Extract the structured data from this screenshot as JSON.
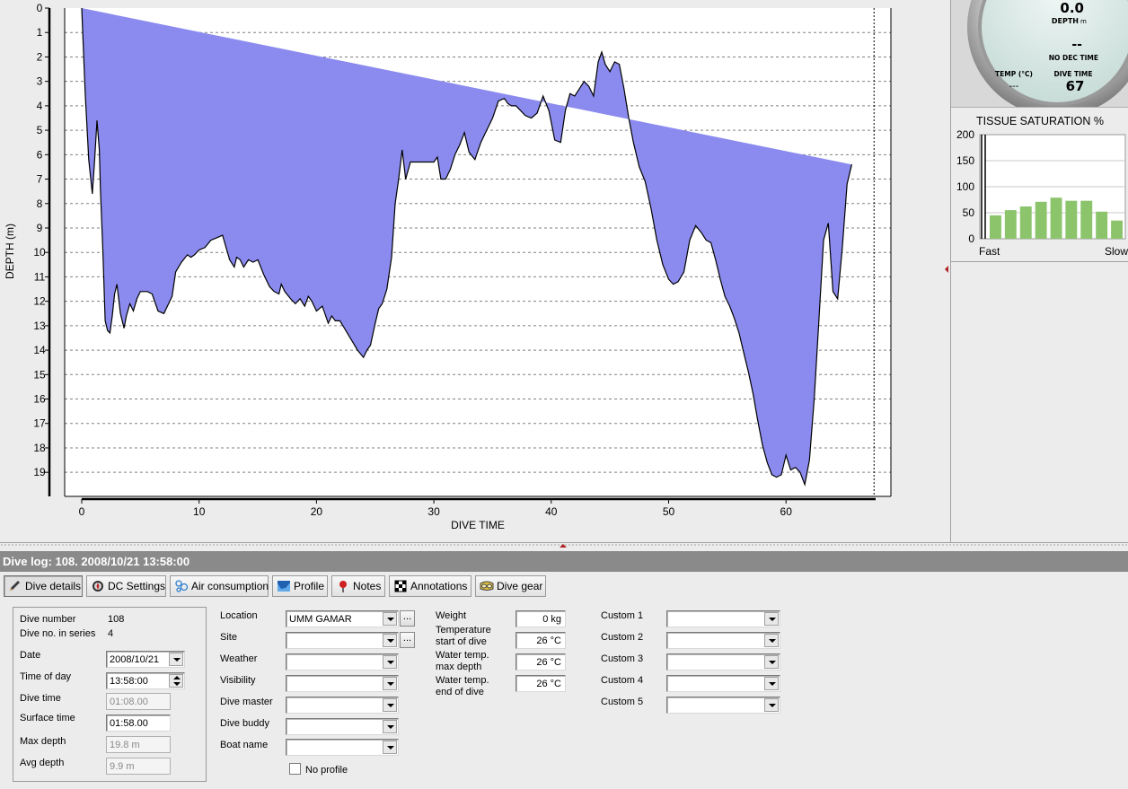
{
  "profile_chart": {
    "ylabel": "DEPTH (m)",
    "xlabel": "DIVE TIME",
    "y_ticks": [
      "0",
      "1",
      "2",
      "3",
      "4",
      "5",
      "6",
      "7",
      "8",
      "9",
      "10",
      "11",
      "12",
      "13",
      "14",
      "15",
      "16",
      "17",
      "18",
      "19"
    ],
    "x_ticks": [
      "0",
      "10",
      "20",
      "30",
      "40",
      "50",
      "60"
    ],
    "fill_color": "#8b8bef",
    "chart_data": {
      "type": "area",
      "xlabel": "DIVE TIME",
      "ylabel": "DEPTH (m)",
      "xlim": [
        0,
        68
      ],
      "ylim": [
        20,
        0
      ],
      "x": [
        0,
        0.3,
        0.6,
        0.9,
        1.1,
        1.3,
        1.5,
        1.6,
        1.8,
        2.0,
        2.2,
        2.4,
        2.6,
        2.8,
        3.0,
        3.3,
        3.6,
        3.8,
        4.1,
        4.4,
        4.7,
        5.0,
        5.3,
        5.6,
        6.0,
        6.5,
        7.0,
        7.3,
        7.7,
        8.0,
        8.5,
        9.0,
        9.3,
        9.6,
        10.0,
        10.5,
        11.0,
        11.5,
        12.0,
        12.6,
        13.0,
        13.2,
        13.5,
        13.8,
        14.2,
        14.6,
        15.0,
        15.5,
        16.0,
        16.4,
        16.8,
        17.0,
        17.3,
        17.8,
        18.2,
        18.6,
        19.0,
        19.3,
        19.6,
        20.0,
        20.5,
        21.0,
        21.3,
        21.6,
        22.0,
        22.5,
        23.0,
        23.5,
        24.0,
        24.3,
        24.6,
        25.0,
        25.3,
        25.6,
        26.0,
        26.4,
        26.7,
        27.0,
        27.3,
        27.6,
        28.0,
        28.3,
        28.6,
        29.0,
        29.5,
        30.0,
        30.3,
        30.6,
        31.0,
        31.4,
        31.8,
        32.2,
        32.6,
        33.0,
        33.5,
        34.0,
        34.5,
        35.0,
        35.5,
        36.0,
        36.3,
        36.6,
        37.0,
        37.4,
        37.8,
        38.3,
        38.8,
        39.3,
        39.8,
        40.3,
        40.8,
        41.2,
        41.6,
        42.0,
        42.4,
        42.8,
        43.2,
        43.6,
        44.0,
        44.3,
        44.6,
        45.0,
        45.4,
        45.8,
        46.2,
        46.6,
        47.0,
        47.5,
        48.0,
        48.5,
        49.0,
        49.5,
        50.0,
        50.4,
        50.8,
        51.3,
        51.8,
        52.3,
        52.8,
        53.2,
        53.6,
        54.0,
        54.4,
        54.8,
        55.2,
        55.6,
        56.0,
        56.4,
        56.8,
        57.2,
        57.6,
        58.0,
        58.4,
        58.8,
        59.2,
        59.6,
        60.0,
        60.4,
        60.8,
        61.2,
        61.6,
        62.0,
        62.4,
        62.8,
        63.2,
        63.6,
        64.0,
        64.4,
        64.8,
        65.2,
        65.6,
        66.0,
        66.4,
        66.8,
        67.2,
        67.5
      ],
      "y": [
        0,
        3.5,
        6.2,
        7.6,
        6.2,
        4.6,
        5.8,
        7.5,
        9.9,
        12.8,
        13.2,
        13.3,
        12.6,
        11.7,
        11.3,
        12.5,
        13.1,
        12.6,
        12.1,
        12.4,
        11.9,
        11.6,
        11.6,
        11.6,
        11.7,
        12.4,
        12.5,
        12.2,
        11.8,
        10.8,
        10.4,
        10.1,
        10.2,
        10.1,
        9.9,
        9.8,
        9.5,
        9.4,
        9.3,
        10.3,
        10.6,
        10.2,
        10.3,
        10.6,
        10.3,
        10.4,
        10.3,
        10.9,
        11.4,
        11.6,
        11.7,
        11.3,
        11.6,
        11.9,
        12.1,
        11.9,
        12.2,
        11.8,
        12.0,
        12.4,
        12.2,
        12.9,
        12.6,
        12.8,
        12.8,
        13.2,
        13.6,
        14.0,
        14.3,
        14.0,
        13.8,
        12.9,
        12.3,
        12.1,
        11.5,
        10.2,
        8.0,
        7.0,
        5.8,
        7.0,
        6.3,
        6.3,
        6.3,
        6.3,
        6.3,
        6.3,
        6.1,
        7.0,
        7.0,
        6.6,
        6.0,
        5.6,
        5.1,
        5.9,
        6.2,
        5.5,
        5.0,
        4.5,
        3.8,
        3.7,
        3.9,
        4.0,
        4.0,
        4.2,
        4.4,
        4.5,
        4.3,
        3.6,
        4.2,
        5.4,
        5.5,
        4.2,
        3.5,
        3.6,
        3.3,
        3.0,
        3.2,
        3.6,
        2.2,
        1.8,
        2.3,
        2.6,
        2.2,
        2.3,
        3.3,
        4.5,
        5.5,
        6.5,
        7.1,
        8.2,
        9.5,
        10.5,
        11.1,
        11.3,
        11.2,
        10.8,
        9.5,
        8.9,
        9.2,
        9.5,
        9.6,
        10.3,
        11.1,
        11.8,
        12.2,
        12.7,
        13.3,
        14.1,
        14.9,
        15.8,
        16.9,
        17.9,
        18.6,
        19.1,
        19.2,
        19.1,
        18.3,
        18.9,
        18.8,
        19.0,
        19.5,
        18.5,
        16.0,
        12.8,
        9.5,
        8.8,
        11.6,
        11.9,
        9.8,
        7.2,
        6.4
      ]
    }
  },
  "gauge": {
    "depth_value": "0.0",
    "depth_label": "DEPTH",
    "depth_unit": "m",
    "deco_value": "--",
    "deco_label": "NO DEC TIME",
    "temp_label": "TEMP (°C)",
    "temp_value": "---",
    "dive_time_label": "DIVE TIME",
    "dive_time_value": "67"
  },
  "tissue": {
    "title": "TISSUE SATURATION %",
    "y_ticks": [
      "0",
      "50",
      "100",
      "150",
      "200"
    ],
    "label_fast": "Fast",
    "label_slow": "Slow",
    "bar_color": "#8cc46c",
    "chart_data": {
      "type": "bar",
      "title": "TISSUE SATURATION %",
      "ylim": [
        0,
        200
      ],
      "values": [
        45,
        55,
        62,
        71,
        79,
        73,
        73,
        52,
        35
      ]
    }
  },
  "dive_log": {
    "title": "Dive log: 108. 2008/10/21 13:58:00"
  },
  "tabs": [
    {
      "label": "Dive details",
      "icon": "pencil-icon"
    },
    {
      "label": "DC Settings",
      "icon": "compass-icon"
    },
    {
      "label": "Air consumption",
      "icon": "bubbles-icon"
    },
    {
      "label": "Profile",
      "icon": "profile-icon"
    },
    {
      "label": "Notes",
      "icon": "pin-icon"
    },
    {
      "label": "Annotations",
      "icon": "flag-icon"
    },
    {
      "label": "Dive gear",
      "icon": "mask-icon"
    }
  ],
  "details": {
    "dive_number_label": "Dive number",
    "dive_number": "108",
    "dive_series_label": "Dive no. in series",
    "dive_series": "4",
    "date_label": "Date",
    "date": "2008/10/21",
    "time_label": "Time of day",
    "time": "13:58:00",
    "dive_time_label": "Dive time",
    "dive_time": "01:08.00",
    "surface_time_label": "Surface time",
    "surface_time": "01:58.00",
    "max_depth_label": "Max depth",
    "max_depth": "19.8 m",
    "avg_depth_label": "Avg depth",
    "avg_depth": "9.9 m"
  },
  "location_fields": {
    "location_label": "Location",
    "location": "UMM GAMAR",
    "site_label": "Site",
    "site": "",
    "weather_label": "Weather",
    "weather": "",
    "visibility_label": "Visibility",
    "visibility": "",
    "dive_master_label": "Dive master",
    "dive_master": "",
    "dive_buddy_label": "Dive buddy",
    "dive_buddy": "",
    "boat_name_label": "Boat name",
    "boat_name": "",
    "no_profile_label": "No profile",
    "ellipsis": "..."
  },
  "weights": {
    "weight_label": "Weight",
    "weight": "0 kg",
    "temp_start_label_1": "Temperature",
    "temp_start_label_2": "start of dive",
    "temp_start": "26 °C",
    "temp_max_label_1": "Water temp.",
    "temp_max_label_2": "max depth",
    "temp_max": "26 °C",
    "temp_end_label_1": "Water temp.",
    "temp_end_label_2": "end of dive",
    "temp_end": "26 °C"
  },
  "custom": {
    "custom1_label": "Custom 1",
    "custom2_label": "Custom 2",
    "custom3_label": "Custom 3",
    "custom4_label": "Custom 4",
    "custom5_label": "Custom 5",
    "custom1": "",
    "custom2": "",
    "custom3": "",
    "custom4": "",
    "custom5": ""
  }
}
